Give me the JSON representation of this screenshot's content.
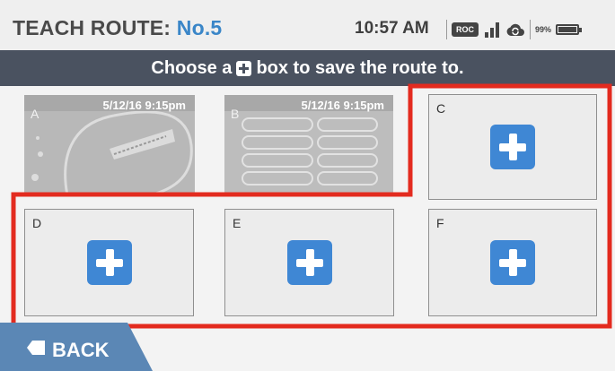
{
  "header": {
    "title_prefix": "TEACH ROUTE: ",
    "title_number": "No.5",
    "time": "10:57 AM",
    "roc_badge": "ROC",
    "battery_text": "99%",
    "icons": [
      "roc-icon",
      "signal-icon",
      "cloud-sync-icon",
      "battery-icon"
    ],
    "battery_level": 0.99
  },
  "banner": {
    "text_before": "Choose a ",
    "text_after": " box to save the route to."
  },
  "slots": [
    {
      "letter": "A",
      "date": "5/12/16 9:15pm",
      "state": "saved"
    },
    {
      "letter": "B",
      "date": "5/12/16 9:15pm",
      "state": "saved"
    },
    {
      "letter": "C",
      "state": "empty"
    },
    {
      "letter": "D",
      "state": "empty"
    },
    {
      "letter": "E",
      "state": "empty"
    },
    {
      "letter": "F",
      "state": "empty"
    }
  ],
  "back": {
    "label": "BACK"
  },
  "colors": {
    "accent": "#3f87d4",
    "title_number": "#3a86c8",
    "banner_bg": "#4a5260",
    "highlight": "#e32b1f",
    "back_bg": "#5b87b5"
  }
}
